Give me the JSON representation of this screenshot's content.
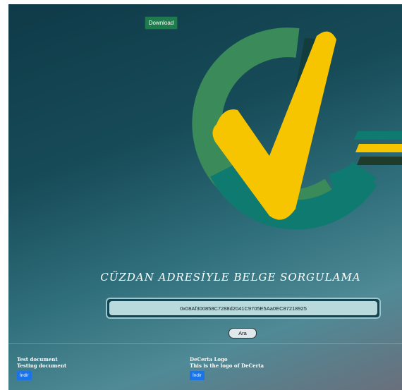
{
  "header": {
    "download_label": "Download"
  },
  "logo": {
    "name": "decerta-check-logo-icon"
  },
  "title": "CÜZDAN ADRESİYLE BELGE SORGULAMA",
  "search": {
    "address_value": "0x08Af300858C7288d2041C9705E5Aa0EC87218925",
    "button_label": "Ara"
  },
  "documents": [
    {
      "name": "Test document",
      "description": "Testing document",
      "button_label": "İndir"
    },
    {
      "name": "DeCerta Logo",
      "description": "This is the logo of DeCerta",
      "button_label": "İndir"
    }
  ],
  "colors": {
    "background_dark": "#0f3a48",
    "logo_green": "#3a8a5a",
    "logo_teal": "#0f7a70",
    "logo_yellow": "#f7c400",
    "button_green": "#1f7a4e",
    "button_blue": "#1a73e8"
  }
}
